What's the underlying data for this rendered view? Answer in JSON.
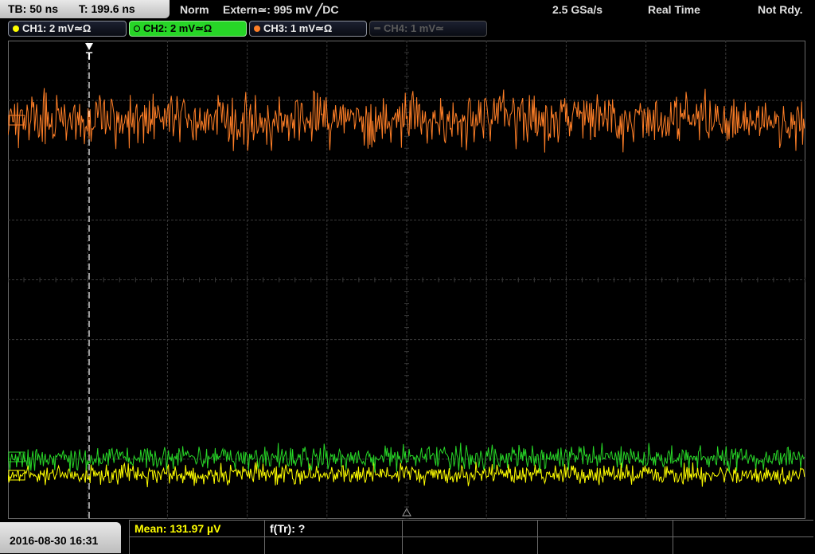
{
  "header": {
    "timebase": "TB: 50 ns",
    "trigger_time": "T: 199.6 ns",
    "mode": "Norm",
    "trigger_source": "Extern≃: 995 mV ╱DC",
    "sample_rate": "2.5 GSa/s",
    "acquisition": "Real Time",
    "state": "Not Rdy."
  },
  "channels": [
    {
      "label": "CH1: 2 mV≃Ω",
      "color": "#ffff00",
      "active": false,
      "enabled": true
    },
    {
      "label": "CH2: 2 mV≃Ω",
      "color": "#27d627",
      "active": true,
      "enabled": true
    },
    {
      "label": "CH3: 1 mV≃Ω",
      "color": "#ff7f27",
      "active": false,
      "enabled": true
    },
    {
      "label": "CH4: 1 mV≃",
      "color": "#4a4a4a",
      "active": false,
      "enabled": false
    }
  ],
  "trigger_marker": "T",
  "footer": {
    "datetime": "2016-08-30 16:31",
    "mean": "Mean: 131.97 µV",
    "ftr": "f(Tr): ?"
  },
  "colors": {
    "ch1": "#ffff00",
    "ch2": "#27d627",
    "ch3": "#ff7f27",
    "grid": "#3a3a3a",
    "background": "#000000"
  }
}
